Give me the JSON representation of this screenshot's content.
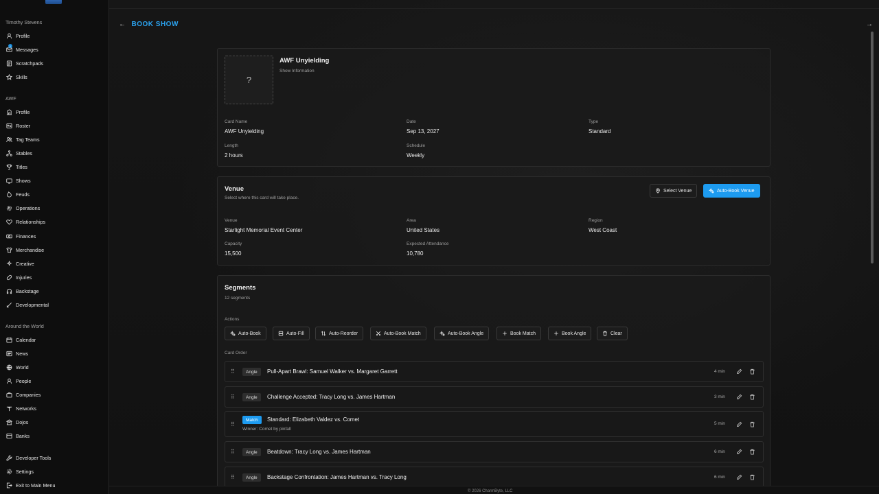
{
  "sidebar": {
    "user_name": "Timothy Stevens",
    "user_items": [
      {
        "label": "Profile",
        "icon": "user-icon"
      },
      {
        "label": "Messages",
        "icon": "mail-icon",
        "badge": "1"
      },
      {
        "label": "Scratchpads",
        "icon": "notepad-icon"
      },
      {
        "label": "Skills",
        "icon": "star-icon"
      }
    ],
    "org_name": "AWF",
    "org_items": [
      {
        "label": "Profile",
        "icon": "building-icon"
      },
      {
        "label": "Roster",
        "icon": "roster-icon"
      },
      {
        "label": "Tag Teams",
        "icon": "users-icon"
      },
      {
        "label": "Stables",
        "icon": "network-icon"
      },
      {
        "label": "Titles",
        "icon": "trophy-icon"
      },
      {
        "label": "Shows",
        "icon": "tv-icon"
      },
      {
        "label": "Feuds",
        "icon": "flame-icon"
      },
      {
        "label": "Operations",
        "icon": "cog-icon"
      },
      {
        "label": "Relationships",
        "icon": "handshake-icon"
      },
      {
        "label": "Finances",
        "icon": "cash-icon"
      },
      {
        "label": "Merchandise",
        "icon": "shirt-icon"
      },
      {
        "label": "Creative",
        "icon": "lightbulb-icon"
      },
      {
        "label": "Injuries",
        "icon": "bandage-icon"
      },
      {
        "label": "Backstage",
        "icon": "headset-icon"
      },
      {
        "label": "Developmental",
        "icon": "sprout-icon"
      }
    ],
    "world_title": "Around the World",
    "world_items": [
      {
        "label": "Calendar",
        "icon": "calendar-icon"
      },
      {
        "label": "News",
        "icon": "newspaper-icon"
      },
      {
        "label": "World",
        "icon": "globe-icon"
      },
      {
        "label": "People",
        "icon": "person-icon"
      },
      {
        "label": "Companies",
        "icon": "briefcase-icon"
      },
      {
        "label": "Networks",
        "icon": "antenna-icon"
      },
      {
        "label": "Dojos",
        "icon": "dojo-icon"
      },
      {
        "label": "Banks",
        "icon": "bank-icon"
      }
    ],
    "bottom_items": [
      {
        "label": "Developer Tools",
        "icon": "wrench-icon"
      },
      {
        "label": "Settings",
        "icon": "gear-icon"
      },
      {
        "label": "Exit to Main Menu",
        "icon": "exit-icon"
      }
    ]
  },
  "header": {
    "title": "BOOK SHOW"
  },
  "show_info": {
    "name": "AWF Unyielding",
    "subtitle": "Show Information",
    "image_placeholder": "?",
    "fields": {
      "card_name_label": "Card Name",
      "card_name": "AWF Unyielding",
      "date_label": "Date",
      "date": "Sep 13, 2027",
      "type_label": "Type",
      "type": "Standard",
      "length_label": "Length",
      "length": "2 hours",
      "schedule_label": "Schedule",
      "schedule": "Weekly"
    }
  },
  "venue": {
    "title": "Venue",
    "subtitle": "Select where this card will take place.",
    "select_button": "Select Venue",
    "autobook_button": "Auto-Book Venue",
    "fields": {
      "venue_label": "Venue",
      "venue": "Starlight Memorial Event Center",
      "area_label": "Area",
      "area": "United States",
      "region_label": "Region",
      "region": "West Coast",
      "capacity_label": "Capacity",
      "capacity": "15,500",
      "attendance_label": "Expected Attendance",
      "attendance": "10,780"
    }
  },
  "segments": {
    "title": "Segments",
    "count": "12 segments",
    "actions_label": "Actions",
    "actions": [
      {
        "label": "Auto-Book",
        "icon": "sparkle-icon"
      },
      {
        "label": "Auto-Fill",
        "icon": "layers-icon"
      },
      {
        "label": "Auto-Reorder",
        "icon": "sort-icon"
      },
      {
        "label": "Auto-Book Match",
        "icon": "swords-icon"
      },
      {
        "label": "Auto-Book Angle",
        "icon": "sparkle-icon"
      },
      {
        "label": "Book Match",
        "icon": "plus-icon"
      },
      {
        "label": "Book Angle",
        "icon": "plus-icon"
      },
      {
        "label": "Clear",
        "icon": "trash-icon"
      }
    ],
    "card_order_label": "Card Order",
    "rows": [
      {
        "tag": "Angle",
        "title": "Pull-Apart Brawl: Samuel Walker vs. Margaret Garrett",
        "duration": "4 min",
        "sub": ""
      },
      {
        "tag": "Angle",
        "title": "Challenge Accepted: Tracy Long vs. James Hartman",
        "duration": "3 min",
        "sub": ""
      },
      {
        "tag": "Match",
        "title": "Standard: Elizabeth Valdez vs. Comet",
        "duration": "5 min",
        "sub": "Winner: Comet by pinfall"
      },
      {
        "tag": "Angle",
        "title": "Beatdown: Tracy Long vs. James Hartman",
        "duration": "6 min",
        "sub": ""
      },
      {
        "tag": "Angle",
        "title": "Backstage Confrontation: James Hartman vs. Tracy Long",
        "duration": "6 min",
        "sub": ""
      }
    ]
  },
  "footer": {
    "copyright": "© 2026 CharmByte, LLC"
  },
  "colors": {
    "accent": "#1d9bf0",
    "background": "#121212",
    "sidebar": "#0e0e0e"
  }
}
